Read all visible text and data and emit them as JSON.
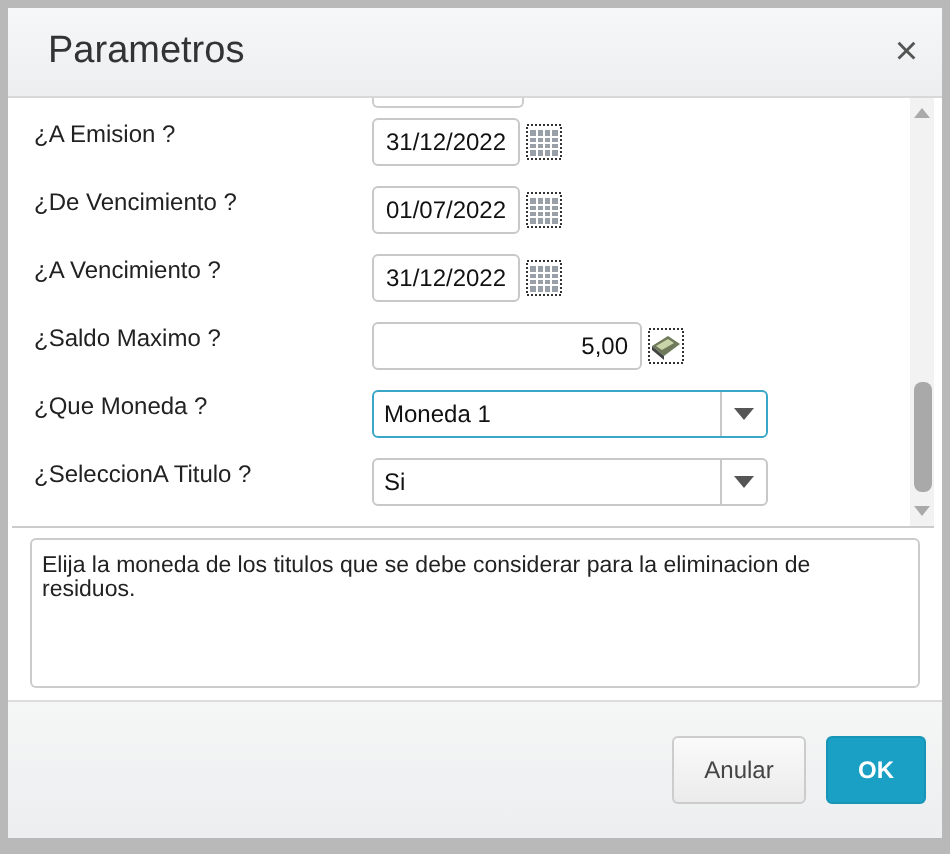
{
  "dialog": {
    "title": "Parametros",
    "close": "×"
  },
  "fields": [
    {
      "label": "¿A Emision ?",
      "kind": "date",
      "value": "31/12/2022",
      "focused": false
    },
    {
      "label": "¿De Vencimiento ?",
      "kind": "date",
      "value": "01/07/2022",
      "focused": false
    },
    {
      "label": "¿A Vencimiento ?",
      "kind": "date",
      "value": "31/12/2022",
      "focused": false
    },
    {
      "label": "¿Saldo Maximo ?",
      "kind": "number",
      "value": "5,00",
      "focused": false
    },
    {
      "label": "¿Que Moneda ?",
      "kind": "select",
      "value": "Moneda 1",
      "focused": true
    },
    {
      "label": "¿SeleccionA Titulo ?",
      "kind": "select",
      "value": "Si",
      "focused": false
    }
  ],
  "help": "Elija la moneda de los titulos que se debe considerar para la eliminacion de residuos.",
  "buttons": [
    {
      "label": "Anular",
      "kind": "secondary"
    },
    {
      "label": "OK",
      "kind": "primary"
    }
  ]
}
